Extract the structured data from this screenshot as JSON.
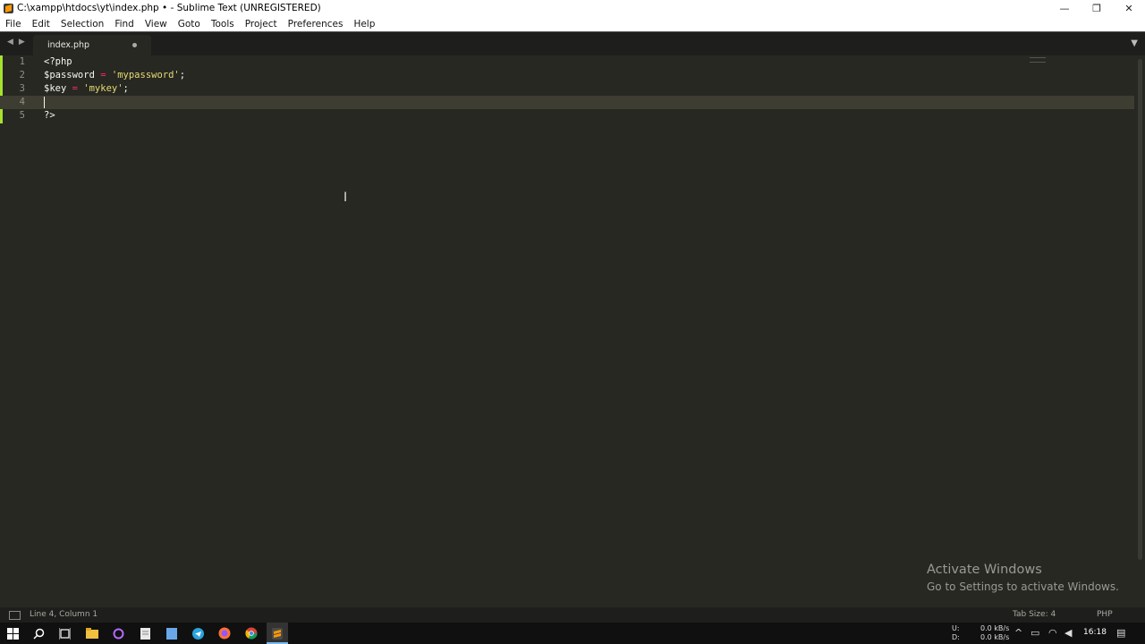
{
  "window": {
    "title": "C:\\xampp\\htdocs\\yt\\index.php • - Sublime Text (UNREGISTERED)",
    "minimize_glyph": "—",
    "restore_glyph": "❐",
    "close_glyph": "✕"
  },
  "menu": {
    "items": [
      "File",
      "Edit",
      "Selection",
      "Find",
      "View",
      "Goto",
      "Tools",
      "Project",
      "Preferences",
      "Help"
    ]
  },
  "tabs": {
    "nav_prev": "◀",
    "nav_next": "▶",
    "active_label": "index.php",
    "dropdown_glyph": "▼"
  },
  "editor": {
    "lines": [
      {
        "num": "1",
        "tokens": [
          {
            "t": "<?php",
            "c": "var"
          }
        ]
      },
      {
        "num": "2",
        "tokens": [
          {
            "t": "$password",
            "c": "var"
          },
          {
            "t": " ",
            "c": "var"
          },
          {
            "t": "=",
            "c": "kw"
          },
          {
            "t": " ",
            "c": "var"
          },
          {
            "t": "'mypassword'",
            "c": "str"
          },
          {
            "t": ";",
            "c": "var"
          }
        ]
      },
      {
        "num": "3",
        "tokens": [
          {
            "t": "$key",
            "c": "var"
          },
          {
            "t": " ",
            "c": "var"
          },
          {
            "t": "=",
            "c": "kw"
          },
          {
            "t": " ",
            "c": "var"
          },
          {
            "t": "'mykey'",
            "c": "str"
          },
          {
            "t": ";",
            "c": "var"
          }
        ]
      },
      {
        "num": "4",
        "tokens": []
      },
      {
        "num": "5",
        "tokens": [
          {
            "t": "?>",
            "c": "var"
          }
        ]
      }
    ],
    "active_line": 4
  },
  "watermark": {
    "title": "Activate Windows",
    "subtitle": "Go to Settings to activate Windows."
  },
  "status": {
    "position": "Line 4, Column 1",
    "tab_size": "Tab Size: 4",
    "syntax": "PHP"
  },
  "taskbar": {
    "net_up_label": "U:",
    "net_down_label": "D:",
    "net_up_value": "0.0 kB/s",
    "net_down_value": "0.0 kB/s",
    "clock": "16:18"
  },
  "colors": {
    "editor_bg": "#272822",
    "keyword": "#f92672",
    "string": "#e6db74",
    "text": "#f8f8f2",
    "gutter_mark": "#a6e22e"
  }
}
